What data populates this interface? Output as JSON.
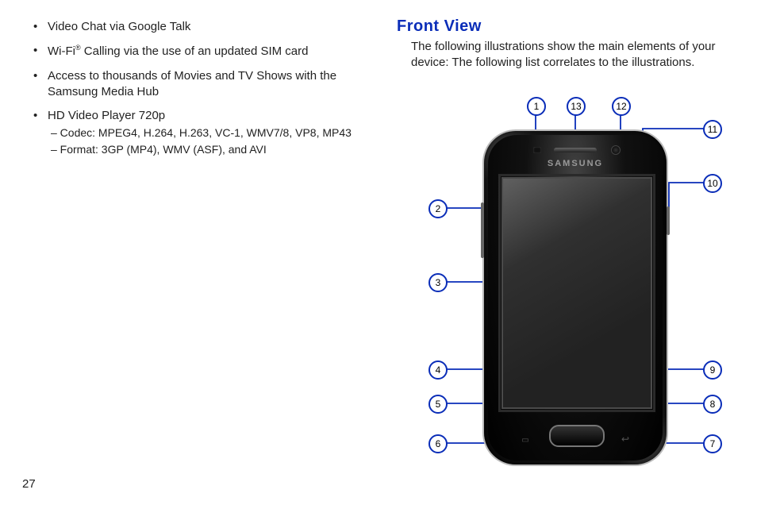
{
  "page_number": "27",
  "left_column": {
    "bullets": [
      {
        "text": "Video Chat via Google Talk"
      },
      {
        "prefix": "Wi-Fi",
        "sup": "®",
        "suffix": " Calling via the use of an updated SIM card"
      },
      {
        "text": "Access to thousands of Movies and TV Shows with the Samsung Media Hub"
      },
      {
        "text": "HD Video Player 720p",
        "sub": [
          "– Codec: MPEG4, H.264, H.263, VC-1, WMV7/8, VP8, MP43",
          "– Format: 3GP (MP4), WMV (ASF), and AVI"
        ]
      }
    ]
  },
  "right_column": {
    "heading": "Front View",
    "intro": "The following illustrations show the main elements of your device: The following list correlates to the illustrations."
  },
  "phone": {
    "brand": "SAMSUNG"
  },
  "callouts": {
    "c1": "1",
    "c2": "2",
    "c3": "3",
    "c4": "4",
    "c5": "5",
    "c6": "6",
    "c7": "7",
    "c8": "8",
    "c9": "9",
    "c10": "10",
    "c11": "11",
    "c12": "12",
    "c13": "13"
  }
}
